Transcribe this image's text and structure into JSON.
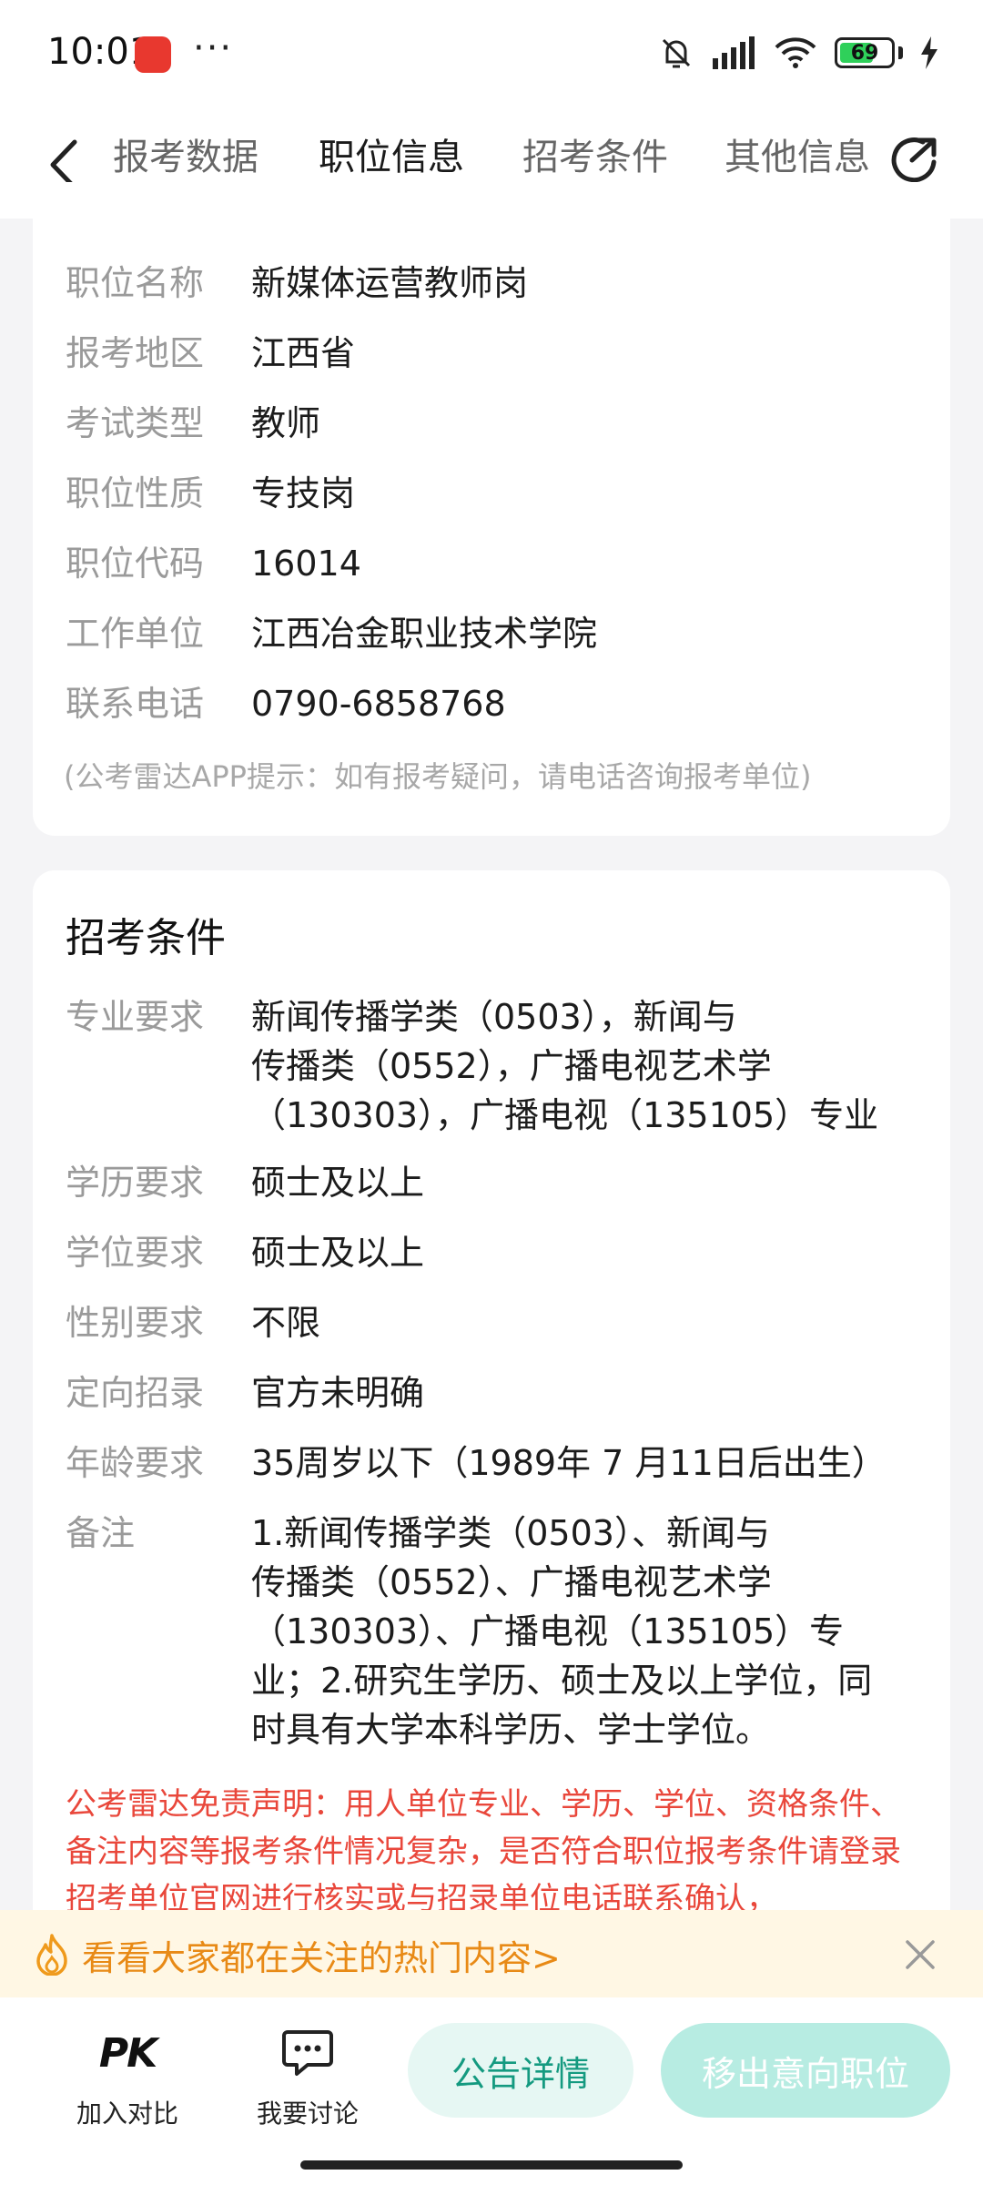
{
  "status_bar": {
    "time": "10:01",
    "more": "···",
    "battery_level": "69"
  },
  "header": {
    "tabs": [
      {
        "label": "报考数据"
      },
      {
        "label": "职位信息"
      },
      {
        "label": "招考条件"
      },
      {
        "label": "其他信息"
      }
    ],
    "active_tab_index": 1,
    "accent_color": "#14b89a"
  },
  "position_info": {
    "rows": [
      {
        "key": "职位名称",
        "value": "新媒体运营教师岗"
      },
      {
        "key": "报考地区",
        "value": "江西省"
      },
      {
        "key": "考试类型",
        "value": "教师"
      },
      {
        "key": "职位性质",
        "value": "专技岗"
      },
      {
        "key": "职位代码",
        "value": "16014"
      },
      {
        "key": "工作单位",
        "value": "江西冶金职业技术学院"
      },
      {
        "key": "联系电话",
        "value": "0790-6858768"
      }
    ],
    "hint": "(公考雷达APP提示：如有报考疑问，请电话咨询报考单位)"
  },
  "conditions": {
    "title": "招考条件",
    "rows": [
      {
        "key": "专业要求",
        "value": "新闻传播学类（0503），新闻与\n传播类（0552），广播电视艺术学\n（130303），广播电视（135105）专业"
      },
      {
        "key": "学历要求",
        "value": "硕士及以上"
      },
      {
        "key": "学位要求",
        "value": "硕士及以上"
      },
      {
        "key": "性别要求",
        "value": "不限"
      },
      {
        "key": "定向招录",
        "value": "官方未明确"
      },
      {
        "key": "年龄要求",
        "value": "35周岁以下（1989年 7 月11日后出生）"
      },
      {
        "key": "备注",
        "value": "1.新闻传播学类（0503）、新闻与\n传播类（0552）、广播电视艺术学\n（130303）、广播电视（135105）专\n业；2.研究生学历、硕士及以上学位，同\n时具有大学本科学历、学士学位。"
      }
    ],
    "disclaimer": "公考雷达免责声明：用人单位专业、学历、学位、资格条件、备注内容等报考条件情况复杂，是否符合职位报考条件请登录招考单位官网进行核实或与招录单位电话联系确认，"
  },
  "banner": {
    "text": "看看大家都在关注的热门内容>"
  },
  "bottom_bar": {
    "compare_icon": "PK",
    "compare_label": "加入对比",
    "discuss_label": "我要讨论",
    "notice_button": "公告详情",
    "remove_button": "移出意向职位"
  }
}
